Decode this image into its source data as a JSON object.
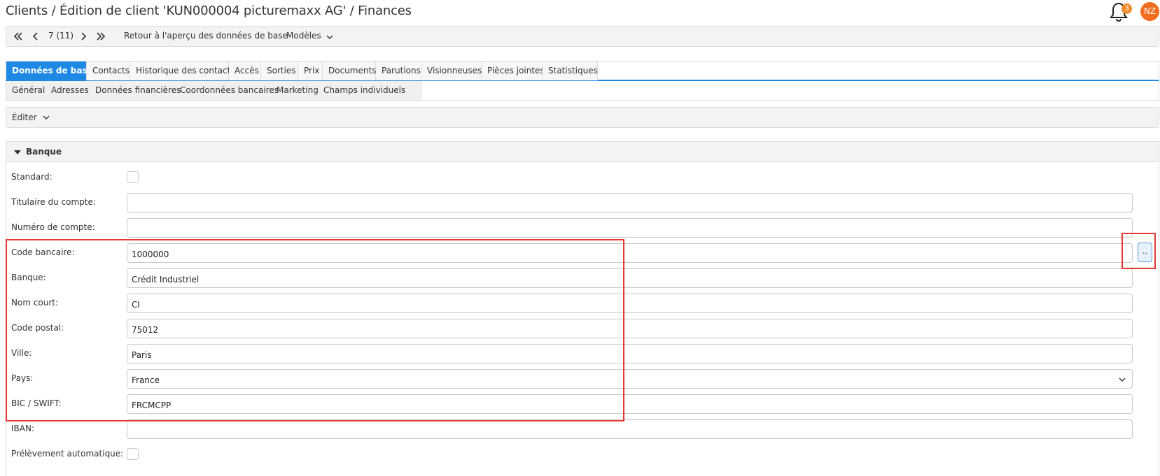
{
  "header": {
    "title": "Clients / Édition de client 'KUN000004 picturemaxx AG' / Finances",
    "notification_count": "3",
    "avatar_initials": "NZ"
  },
  "navbar": {
    "position": "7 (11)",
    "back_label": "Retour à l'aperçu des données de base",
    "templates_label": "Modèles"
  },
  "tabs": [
    {
      "label": "Données de base"
    },
    {
      "label": "Contacts"
    },
    {
      "label": "Historique des contacts"
    },
    {
      "label": "Accès"
    },
    {
      "label": "Sorties"
    },
    {
      "label": "Prix"
    },
    {
      "label": "Documents"
    },
    {
      "label": "Parutions"
    },
    {
      "label": "Visionneuses"
    },
    {
      "label": "Pièces jointes"
    },
    {
      "label": "Statistiques"
    }
  ],
  "subtabs": [
    {
      "label": "Général"
    },
    {
      "label": "Adresses"
    },
    {
      "label": "Données financières"
    },
    {
      "label": "Coordonnées bancaires"
    },
    {
      "label": "Marketing"
    },
    {
      "label": "Champs individuels"
    }
  ],
  "editbar": {
    "label": "Éditer"
  },
  "panel": {
    "title": "Banque"
  },
  "fields": {
    "standard": {
      "label": "Standard:"
    },
    "account_holder": {
      "label": "Titulaire du compte:",
      "value": ""
    },
    "account_number": {
      "label": "Numéro de compte:",
      "value": ""
    },
    "bank_code": {
      "label": "Code bancaire:",
      "value": "1000000"
    },
    "bank": {
      "label": "Banque:",
      "value": "Crédit Industriel"
    },
    "short_name": {
      "label": "Nom court:",
      "value": "CI"
    },
    "postal_code": {
      "label": "Code postal:",
      "value": "75012"
    },
    "city": {
      "label": "Ville:",
      "value": "Paris"
    },
    "country": {
      "label": "Pays:",
      "value": "France"
    },
    "bic": {
      "label": "BIC / SWIFT:",
      "value": "FRCMCPP"
    },
    "iban": {
      "label": "IBAN:",
      "value": ""
    },
    "direct_debit": {
      "label": "Prélèvement automatique:"
    }
  },
  "lookup_button": {
    "label": ".."
  },
  "colors": {
    "accent": "#1e88e5",
    "highlight": "#e53935",
    "avatar": "#f26c1f",
    "badge": "#f08c2c"
  }
}
